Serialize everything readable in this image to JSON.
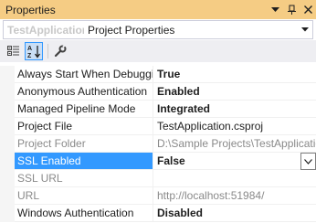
{
  "window": {
    "title": "Properties"
  },
  "title_buttons": {
    "dropdown_glyph": "▾",
    "pin_glyph": "⊞",
    "close_glyph": "✕"
  },
  "object_selector": {
    "name": "TestApplication",
    "type": "Project Properties"
  },
  "toolbar": {
    "categorized": "categorized-icon",
    "alphabetical": "alphabetical-icon",
    "property_pages": "wrench-icon"
  },
  "properties": [
    {
      "name": "Always Start When Debugging",
      "value": "True",
      "bold": true
    },
    {
      "name": "Anonymous Authentication",
      "value": "Enabled",
      "bold": true
    },
    {
      "name": "Managed Pipeline Mode",
      "value": "Integrated",
      "bold": true
    },
    {
      "name": "Project File",
      "value": "TestApplication.csproj",
      "bold": false
    },
    {
      "name": "Project Folder",
      "value": "D:\\Sample Projects\\TestApplication",
      "bold": false,
      "readonly": true
    },
    {
      "name": "SSL Enabled",
      "value": "False",
      "bold": true,
      "selected": true
    },
    {
      "name": "SSL URL",
      "value": "",
      "bold": false,
      "readonly": true
    },
    {
      "name": "URL",
      "value": "http://localhost:51984/",
      "bold": false,
      "readonly": true
    },
    {
      "name": "Windows Authentication",
      "value": "Disabled",
      "bold": true
    }
  ],
  "colors": {
    "title_bar": "#f5cc84",
    "selection": "#3399ff",
    "toolbar": "#eeeef2"
  }
}
